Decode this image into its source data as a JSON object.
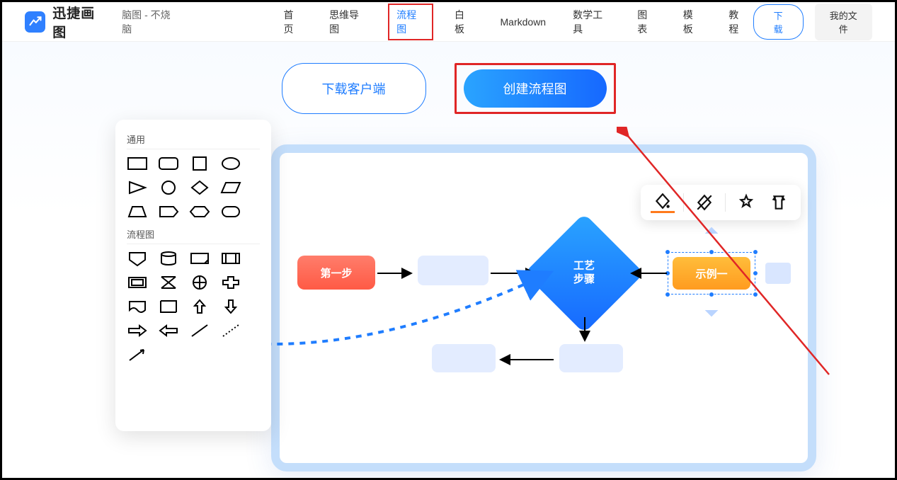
{
  "header": {
    "brand": "迅捷画图",
    "tagline": "脑图 - 不烧脑",
    "nav": [
      {
        "label": "首页"
      },
      {
        "label": "思维导图"
      },
      {
        "label": "流程图"
      },
      {
        "label": "白板"
      },
      {
        "label": "Markdown"
      },
      {
        "label": "数学工具"
      },
      {
        "label": "图表"
      },
      {
        "label": "模板"
      },
      {
        "label": "教程"
      }
    ],
    "download": "下载",
    "my_files": "我的文件"
  },
  "cta": {
    "download_client": "下载客户端",
    "create_flowchart": "创建流程图"
  },
  "shapes_panel": {
    "section_general": "通用",
    "section_flowchart": "流程图"
  },
  "canvas": {
    "node_step1": "第一步",
    "node_decision": "工艺\n步骤",
    "node_example": "示例一"
  }
}
